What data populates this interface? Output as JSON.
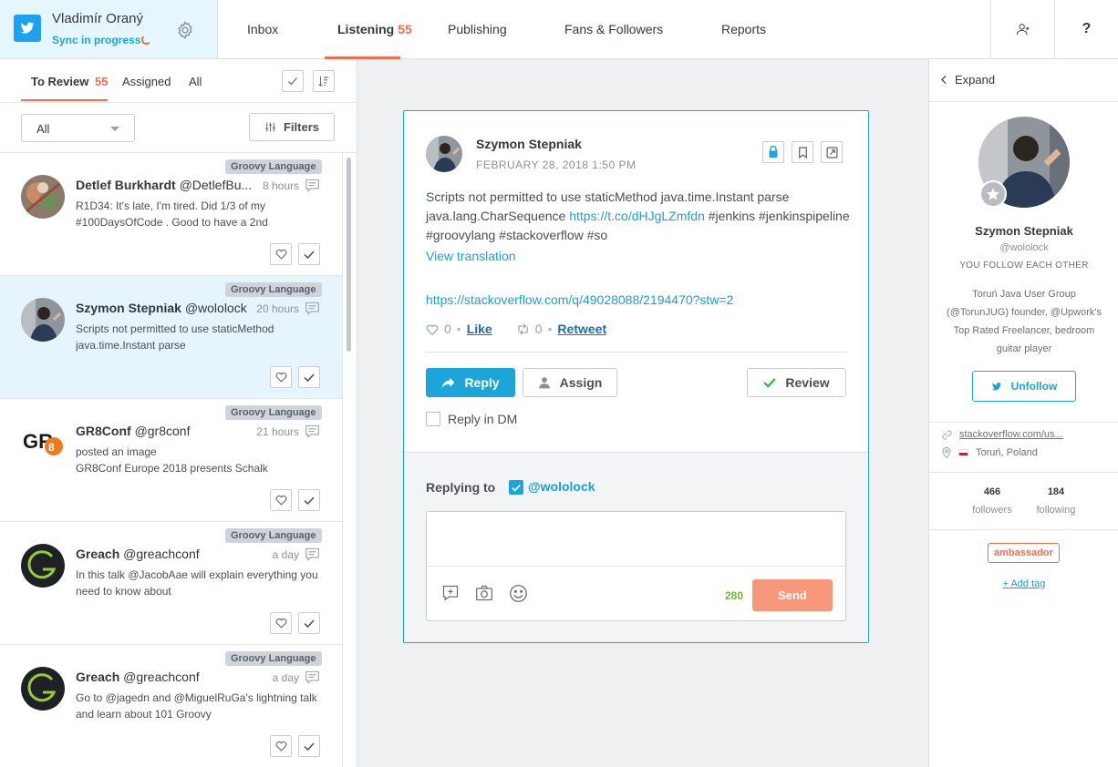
{
  "account": {
    "name": "Vladimír Oraný",
    "sync_status": "Sync in progress"
  },
  "nav": {
    "inbox": "Inbox",
    "listening": "Listening",
    "listening_count": "55",
    "publishing": "Publishing",
    "fans": "Fans & Followers",
    "reports": "Reports",
    "help": "?"
  },
  "left": {
    "tabs": {
      "to_review": "To Review",
      "to_review_count": "55",
      "assigned": "Assigned",
      "all": "All"
    },
    "filter_select": "All",
    "filters_button": "Filters",
    "messages": [
      {
        "tag": "Groovy Language",
        "name": "Detlef Burkhardt",
        "handle": "@DetlefBu...",
        "time": "8 hours",
        "text": "R1D34: It's late, I'm tired. Did 1/3 of my #100DaysOfCode . Good to have a 2nd"
      },
      {
        "tag": "Groovy Language",
        "name": "Szymon Stepniak",
        "handle": "@wololock",
        "time": "20 hours",
        "text": "Scripts not permitted to use staticMethod java.time.Instant parse"
      },
      {
        "tag": "Groovy Language",
        "name": "GR8Conf",
        "handle": "@gr8conf",
        "time": "21 hours",
        "text": "posted an image\nGR8Conf Europe 2018 presents Schalk"
      },
      {
        "tag": "Groovy Language",
        "name": "Greach",
        "handle": "@greachconf",
        "time": "a day",
        "text": "In this talk @JacobAae will explain everything you need to know about"
      },
      {
        "tag": "Groovy Language",
        "name": "Greach",
        "handle": "@greachconf",
        "time": "a day",
        "text": "Go to @jagedn and @MiguelRuGa's lightning talk and learn about 101 Groovy"
      }
    ]
  },
  "post": {
    "author": "Szymon Stepniak",
    "date": "FEBRUARY 28, 2018 1:50 PM",
    "text_before": "Scripts not permitted to use staticMethod java.time.Instant parse java.lang.CharSequence ",
    "text_link": "https://t.co/dHJgLZmfdn",
    "text_after": " #jenkins #jenkinspipeline #groovylang #stackoverflow #so",
    "view_translation": "View translation",
    "url": "https://stackoverflow.com/q/49028088/2194470?stw=2",
    "likes": "0",
    "like_label": "Like",
    "retweets": "0",
    "retweet_label": "Retweet",
    "reply_button": "Reply",
    "assign_button": "Assign",
    "review_button": "Review",
    "reply_dm": "Reply in DM"
  },
  "composer": {
    "replying_to": "Replying to",
    "handle": "@wololock",
    "char_count": "280",
    "send": "Send"
  },
  "profile": {
    "expand": "Expand",
    "name": "Szymon Stepniak",
    "handle": "@wololock",
    "relationship": "YOU FOLLOW EACH OTHER",
    "bio": "Toruń Java User Group (@TorunJUG) founder, @Upwork's Top Rated Freelancer, bedroom guitar player",
    "unfollow": "Unfollow",
    "website": "stackoverflow.com/us...",
    "location": "Toruń, Poland",
    "followers": "466",
    "followers_label": "followers",
    "following": "184",
    "following_label": "following",
    "tag": "ambassador",
    "add_tag": "+ Add tag"
  },
  "colors": {
    "accent": "#1ba5d8",
    "brand_orange": "#f26c4f",
    "twitter": "#1da1f2",
    "send": "#f8987a"
  }
}
